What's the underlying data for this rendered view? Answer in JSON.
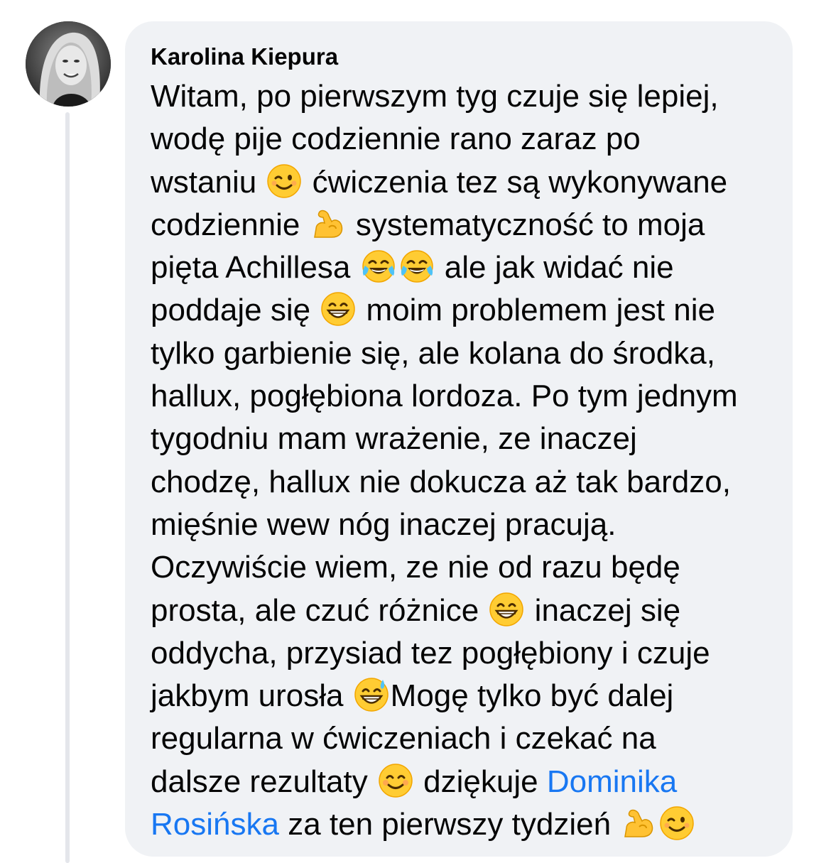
{
  "comment": {
    "author": "Karolina Kiepura",
    "mention_first": "Dominika",
    "mention_second": "Rosińska",
    "lines": {
      "l1": "Witam, po pierwszym tyg czuje się lepiej,",
      "l2": "wodę pije codziennie rano zaraz po",
      "l3a": "wstaniu ",
      "l3b": " ćwiczenia tez są wykonywane",
      "l4a": "codziennie ",
      "l4b": " systematyczność to moja",
      "l5a": "pięta Achillesa ",
      "l5b": " ale jak widać nie",
      "l6a": "poddaje się ",
      "l6b": " moim problemem jest nie",
      "l7": "tylko garbienie się, ale kolana do środka,",
      "l8": "hallux, pogłębiona lordoza. Po tym jednym",
      "l9": "tygodniu mam wrażenie, ze inaczej",
      "l10": "chodzę, hallux nie dokucza aż tak bardzo,",
      "l11": "mięśnie wew nóg inaczej pracują.",
      "l12": "Oczywiście wiem, ze nie od razu będę",
      "l13a": "prosta, ale czuć różnice ",
      "l13b": " inaczej się",
      "l14": "oddycha, przysiad tez pogłębiony i czuje",
      "l15a": "jakbym urosła ",
      "l15b": "Mogę tylko być dalej",
      "l16": "regularna w ćwiczeniach i czekać na",
      "l17a": "dalsze rezultaty ",
      "l17b": " dziękuje ",
      "l18b": " za ten pierwszy tydzień "
    },
    "emojis": [
      "winking-face",
      "flexed-biceps",
      "face-with-tears-of-joy",
      "face-with-tears-of-joy",
      "beaming-face",
      "beaming-face",
      "grinning-face-with-sweat",
      "smiling-face",
      "flexed-biceps",
      "winking-face"
    ]
  },
  "colors": {
    "bubble_background": "#f0f2f5",
    "text": "#050505",
    "mention": "#1877f2",
    "thread_line": "#e4e6eb"
  }
}
